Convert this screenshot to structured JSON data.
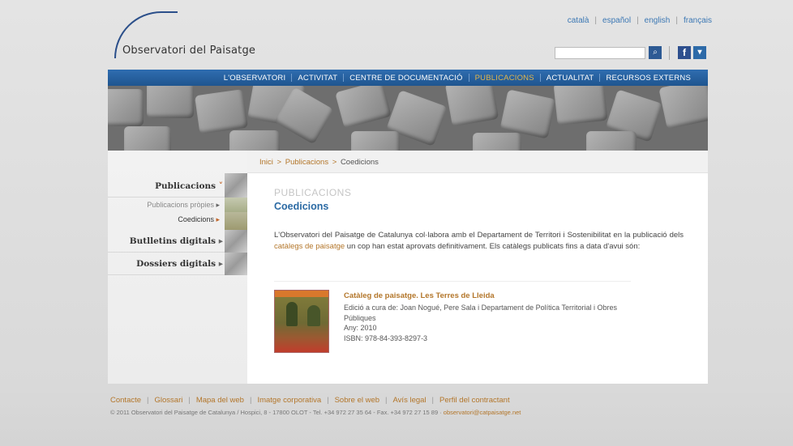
{
  "header": {
    "logo_text": "Observatori del Paisatge",
    "languages": [
      "català",
      "español",
      "english",
      "français"
    ],
    "search_icon_glyph": "⌕",
    "facebook_glyph": "f",
    "twitter_glyph": "▾"
  },
  "nav": {
    "items": [
      {
        "label": "L'OBSERVATORI",
        "active": false
      },
      {
        "label": "ACTIVITAT",
        "active": false
      },
      {
        "label": "CENTRE DE DOCUMENTACIÓ",
        "active": false
      },
      {
        "label": "PUBLICACIONS",
        "active": true
      },
      {
        "label": "ACTUALITAT",
        "active": false
      },
      {
        "label": "RECURSOS EXTERNS",
        "active": false
      }
    ]
  },
  "breadcrumb": {
    "home": "Inici",
    "section": "Publicacions",
    "current": "Coedicions",
    "separator": ">"
  },
  "sidebar": {
    "publicacions": "Publicacions",
    "sub_propies": "Publicacions pròpies",
    "sub_coedicions": "Coedicions",
    "butlletins": "Butlletins digitals",
    "dossiers": "Dossiers digitals",
    "arrow_down": "˅",
    "arrow_right": "▸"
  },
  "main": {
    "section_label": "PUBLICACIONS",
    "title": "Coedicions",
    "intro_part1": "L'Observatori del Paisatge de Catalunya col·labora amb el Departament de Territori i Sostenibilitat en la publicació dels ",
    "intro_link": "catàlegs de paisatge",
    "intro_part2": " un cop han estat aprovats definitivament. Els catàlegs publicats fins a data d'avui són:",
    "book": {
      "title": "Catàleg de paisatge. Les Terres de Lleida",
      "edited": "Edició a cura de: Joan Nogué, Pere Sala i Departament de Política Territorial i Obres Públiques",
      "year": "Any: 2010",
      "isbn": "ISBN: 978-84-393-8297-3"
    }
  },
  "footer": {
    "links": [
      "Contacte",
      "Glossari",
      "Mapa del web",
      "Imatge corporativa",
      "Sobre el web",
      "Avís legal",
      "Perfil del contractant"
    ],
    "copyright": "© 2011 Observatori del Paisatge de Catalunya / Hospici, 8 - 17800 OLOT - Tel. +34 972 27 35 64 - Fax. +34 972 27 15 89 · ",
    "email": "observatori@catpaisatge.net"
  },
  "colors": {
    "nav_blue": "#1f558f",
    "accent_orange": "#b3762a",
    "active_nav": "#e1b54d",
    "title_blue": "#2b6aa4"
  }
}
